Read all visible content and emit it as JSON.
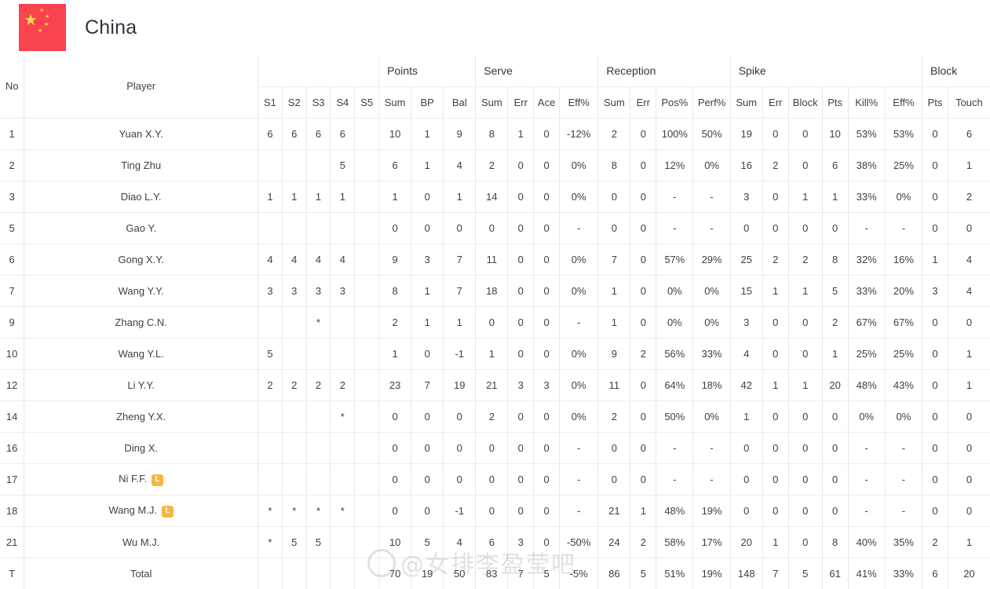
{
  "team": {
    "name": "China",
    "flag_color": "#f9434f",
    "star_color": "#ffd94a",
    "flag_icon": "china-flag-icon"
  },
  "watermark": {
    "text": "@女排李盈莹吧"
  },
  "table": {
    "groups": [
      {
        "label": "",
        "span": 2
      },
      {
        "label": "",
        "span": 5
      },
      {
        "label": "Points",
        "span": 3
      },
      {
        "label": "Serve",
        "span": 4
      },
      {
        "label": "Reception",
        "span": 4
      },
      {
        "label": "Spike",
        "span": 6
      },
      {
        "label": "Block",
        "span": 2
      }
    ],
    "columns": {
      "no": "No",
      "player": "Player",
      "sets": [
        "S1",
        "S2",
        "S3",
        "S4",
        "S5"
      ],
      "points": [
        "Sum",
        "BP",
        "Bal"
      ],
      "serve": [
        "Sum",
        "Err",
        "Ace",
        "Eff%"
      ],
      "reception": [
        "Sum",
        "Err",
        "Pos%",
        "Perf%"
      ],
      "spike": [
        "Sum",
        "Err",
        "Block",
        "Pts",
        "Kill%",
        "Eff%"
      ],
      "block": [
        "Pts",
        "Touch"
      ]
    },
    "rows": [
      {
        "no": "1",
        "player": "Yuan X.Y.",
        "libero": false,
        "cells": [
          "6",
          "6",
          "6",
          "6",
          "",
          "10",
          "1",
          "9",
          "8",
          "1",
          "0",
          "-12%",
          "2",
          "0",
          "100%",
          "50%",
          "19",
          "0",
          "0",
          "10",
          "53%",
          "53%",
          "0",
          "6"
        ]
      },
      {
        "no": "2",
        "player": "Ting Zhu",
        "libero": false,
        "cells": [
          "",
          "",
          "",
          "5",
          "",
          "6",
          "1",
          "4",
          "2",
          "0",
          "0",
          "0%",
          "8",
          "0",
          "12%",
          "0%",
          "16",
          "2",
          "0",
          "6",
          "38%",
          "25%",
          "0",
          "1"
        ]
      },
      {
        "no": "3",
        "player": "Diao L.Y.",
        "libero": false,
        "cells": [
          "1",
          "1",
          "1",
          "1",
          "",
          "1",
          "0",
          "1",
          "14",
          "0",
          "0",
          "0%",
          "0",
          "0",
          "-",
          "-",
          "3",
          "0",
          "1",
          "1",
          "33%",
          "0%",
          "0",
          "2"
        ]
      },
      {
        "no": "5",
        "player": "Gao Y.",
        "libero": false,
        "cells": [
          "",
          "",
          "",
          "",
          "",
          "0",
          "0",
          "0",
          "0",
          "0",
          "0",
          "-",
          "0",
          "0",
          "-",
          "-",
          "0",
          "0",
          "0",
          "0",
          "-",
          "-",
          "0",
          "0"
        ]
      },
      {
        "no": "6",
        "player": "Gong X.Y.",
        "libero": false,
        "cells": [
          "4",
          "4",
          "4",
          "4",
          "",
          "9",
          "3",
          "7",
          "11",
          "0",
          "0",
          "0%",
          "7",
          "0",
          "57%",
          "29%",
          "25",
          "2",
          "2",
          "8",
          "32%",
          "16%",
          "1",
          "4"
        ]
      },
      {
        "no": "7",
        "player": "Wang Y.Y.",
        "libero": false,
        "cells": [
          "3",
          "3",
          "3",
          "3",
          "",
          "8",
          "1",
          "7",
          "18",
          "0",
          "0",
          "0%",
          "1",
          "0",
          "0%",
          "0%",
          "15",
          "1",
          "1",
          "5",
          "33%",
          "20%",
          "3",
          "4"
        ]
      },
      {
        "no": "9",
        "player": "Zhang C.N.",
        "libero": false,
        "cells": [
          "",
          "",
          "*",
          "",
          "",
          "2",
          "1",
          "1",
          "0",
          "0",
          "0",
          "-",
          "1",
          "0",
          "0%",
          "0%",
          "3",
          "0",
          "0",
          "2",
          "67%",
          "67%",
          "0",
          "0"
        ]
      },
      {
        "no": "10",
        "player": "Wang Y.L.",
        "libero": false,
        "cells": [
          "5",
          "",
          "",
          "",
          "",
          "1",
          "0",
          "-1",
          "1",
          "0",
          "0",
          "0%",
          "9",
          "2",
          "56%",
          "33%",
          "4",
          "0",
          "0",
          "1",
          "25%",
          "25%",
          "0",
          "1"
        ]
      },
      {
        "no": "12",
        "player": "Li Y.Y.",
        "libero": false,
        "cells": [
          "2",
          "2",
          "2",
          "2",
          "",
          "23",
          "7",
          "19",
          "21",
          "3",
          "3",
          "0%",
          "11",
          "0",
          "64%",
          "18%",
          "42",
          "1",
          "1",
          "20",
          "48%",
          "43%",
          "0",
          "1"
        ]
      },
      {
        "no": "14",
        "player": "Zheng Y.X.",
        "libero": false,
        "cells": [
          "",
          "",
          "",
          "*",
          "",
          "0",
          "0",
          "0",
          "2",
          "0",
          "0",
          "0%",
          "2",
          "0",
          "50%",
          "0%",
          "1",
          "0",
          "0",
          "0",
          "0%",
          "0%",
          "0",
          "0"
        ]
      },
      {
        "no": "16",
        "player": "Ding X.",
        "libero": false,
        "cells": [
          "",
          "",
          "",
          "",
          "",
          "0",
          "0",
          "0",
          "0",
          "0",
          "0",
          "-",
          "0",
          "0",
          "-",
          "-",
          "0",
          "0",
          "0",
          "0",
          "-",
          "-",
          "0",
          "0"
        ]
      },
      {
        "no": "17",
        "player": "Ni F.F.",
        "libero": true,
        "cells": [
          "",
          "",
          "",
          "",
          "",
          "0",
          "0",
          "0",
          "0",
          "0",
          "0",
          "-",
          "0",
          "0",
          "-",
          "-",
          "0",
          "0",
          "0",
          "0",
          "-",
          "-",
          "0",
          "0"
        ]
      },
      {
        "no": "18",
        "player": "Wang M.J.",
        "libero": true,
        "cells": [
          "*",
          "*",
          "*",
          "*",
          "",
          "0",
          "0",
          "-1",
          "0",
          "0",
          "0",
          "-",
          "21",
          "1",
          "48%",
          "19%",
          "0",
          "0",
          "0",
          "0",
          "-",
          "-",
          "0",
          "0"
        ]
      },
      {
        "no": "21",
        "player": "Wu M.J.",
        "libero": false,
        "cells": [
          "*",
          "5",
          "5",
          "",
          "",
          "10",
          "5",
          "4",
          "6",
          "3",
          "0",
          "-50%",
          "24",
          "2",
          "58%",
          "17%",
          "20",
          "1",
          "0",
          "8",
          "40%",
          "35%",
          "2",
          "1"
        ]
      }
    ],
    "total_row": {
      "no": "T",
      "player": "Total",
      "cells": [
        "",
        "",
        "",
        "",
        "",
        "70",
        "19",
        "50",
        "83",
        "7",
        "5",
        "-5%",
        "86",
        "5",
        "51%",
        "19%",
        "148",
        "7",
        "5",
        "61",
        "41%",
        "33%",
        "6",
        "20"
      ]
    },
    "libero_badge": "L"
  }
}
